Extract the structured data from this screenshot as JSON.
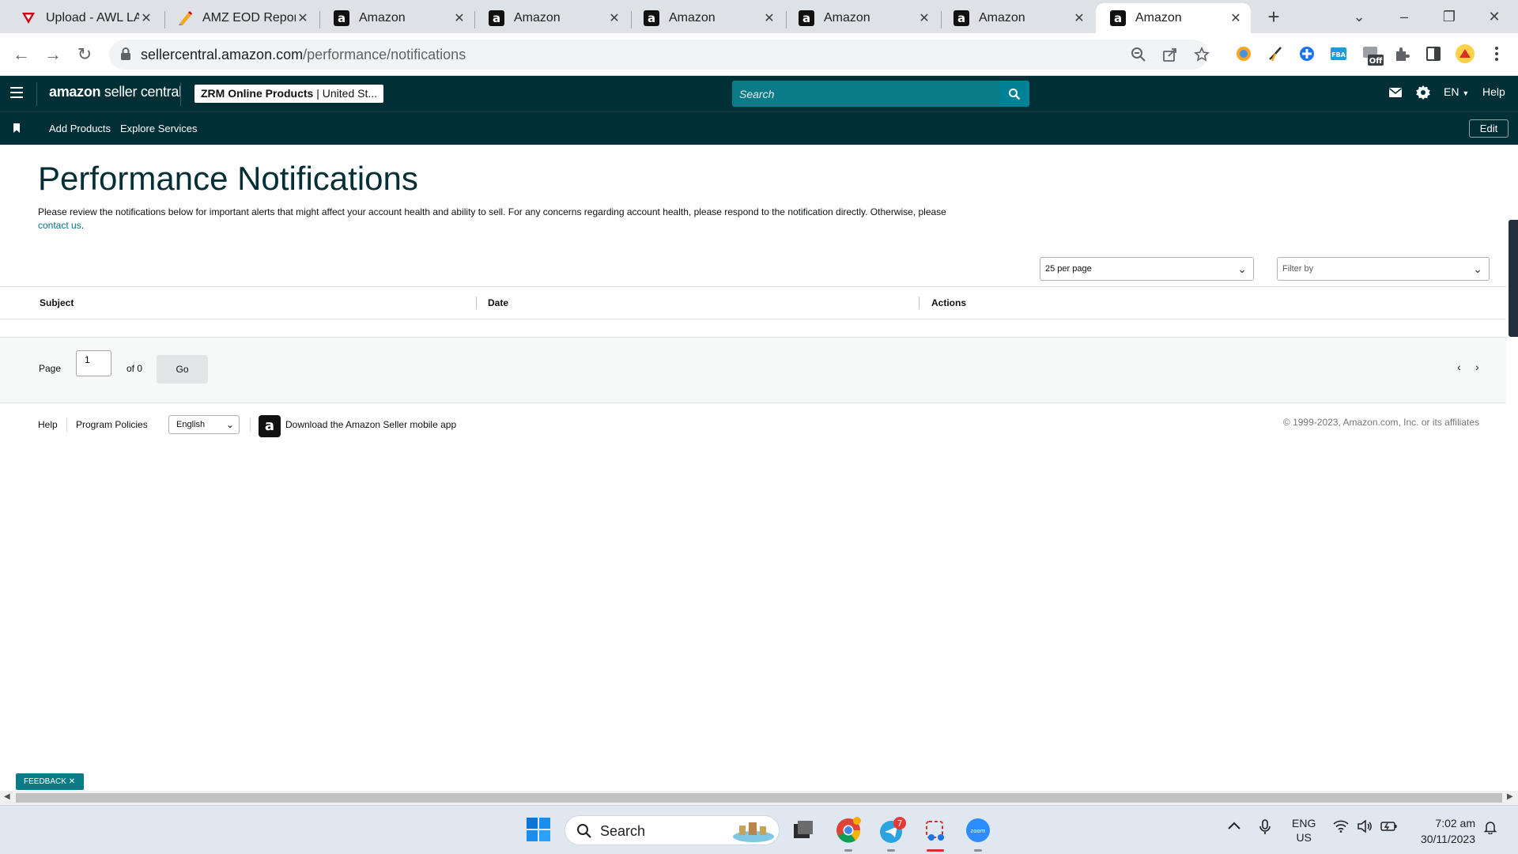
{
  "browser": {
    "tabs": [
      {
        "title": "Upload - AWL LA",
        "favicon": "red-triangle-icon"
      },
      {
        "title": "AMZ EOD Report",
        "favicon": "pen-icon"
      },
      {
        "title": "Amazon",
        "favicon": "amazon-a-icon"
      },
      {
        "title": "Amazon",
        "favicon": "amazon-a-icon"
      },
      {
        "title": "Amazon",
        "favicon": "amazon-a-icon"
      },
      {
        "title": "Amazon",
        "favicon": "amazon-a-icon"
      },
      {
        "title": "Amazon",
        "favicon": "amazon-a-icon"
      },
      {
        "title": "Amazon",
        "favicon": "amazon-a-icon",
        "active": true
      }
    ],
    "url_host": "sellercentral.amazon.com",
    "url_path": "/performance/notifications",
    "ext_badge": "Off"
  },
  "header": {
    "logo_brand": "amazon",
    "logo_product": "seller central",
    "store_name": "ZRM Online Products",
    "store_region": "| United St...",
    "search_placeholder": "Search",
    "language": "EN",
    "help": "Help"
  },
  "subnav": {
    "links": [
      "Add Products",
      "Explore Services"
    ],
    "edit": "Edit"
  },
  "page": {
    "title": "Performance Notifications",
    "intro": "Please review the notifications below for important alerts that might affect your account health and ability to sell. For any concerns regarding account health, please respond to the notification directly. Otherwise, please",
    "contact_link": "contact us",
    "per_page": "25 per page",
    "filter_placeholder": "Filter by"
  },
  "table": {
    "columns": [
      "Subject",
      "Date",
      "Actions"
    ],
    "rows": []
  },
  "pager": {
    "page_label": "Page",
    "page_value": "1",
    "of_label": "of 0",
    "go": "Go"
  },
  "footer": {
    "help": "Help",
    "policies": "Program Policies",
    "language": "English",
    "app_link": "Download the Amazon Seller mobile app",
    "copyright": "© 1999-2023, Amazon.com, Inc. or its affiliates"
  },
  "feedback": "FEEDBACK",
  "taskbar": {
    "search": "Search",
    "telegram_badge": "7",
    "zoom_label": "zoom",
    "lang_line1": "ENG",
    "lang_line2": "US",
    "time": "7:02 am",
    "date": "30/11/2023"
  },
  "colors": {
    "header_bg": "#002f36",
    "search_bg": "#0b7b87",
    "link": "#007185",
    "title": "#002f36"
  }
}
